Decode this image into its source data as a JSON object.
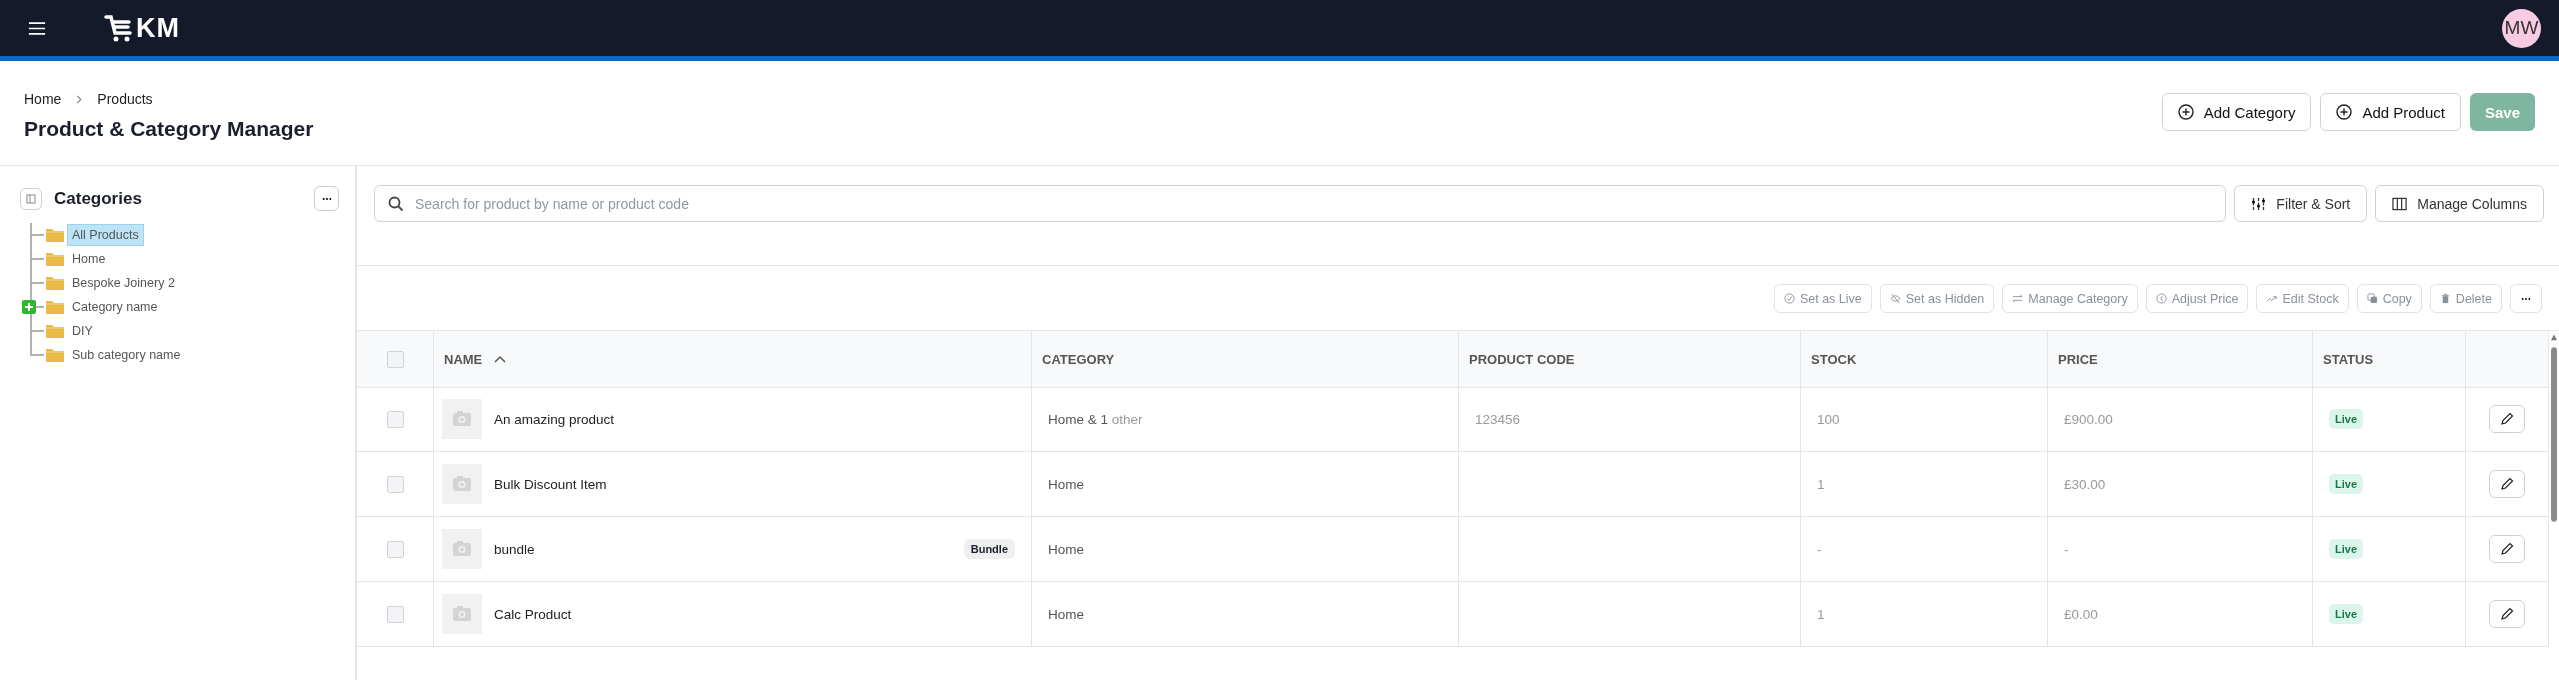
{
  "topbar": {
    "logo_text": "KM",
    "avatar": "MW"
  },
  "breadcrumb": [
    {
      "label": "Home"
    },
    {
      "label": "Products"
    }
  ],
  "page_title": "Product & Category Manager",
  "header_buttons": [
    {
      "label": "Add Category",
      "kind": "outline"
    },
    {
      "label": "Add Product",
      "kind": "outline"
    },
    {
      "label": "Save",
      "kind": "primary",
      "disabled": true
    }
  ],
  "sidebar": {
    "title": "Categories",
    "items": [
      {
        "label": "All Products",
        "selected": true,
        "drop_target": false
      },
      {
        "label": "Home",
        "selected": false,
        "drop_target": false
      },
      {
        "label": "Bespoke Joinery 2",
        "selected": false,
        "drop_target": false
      },
      {
        "label": "Category name",
        "selected": false,
        "drop_target": true
      },
      {
        "label": "DIY",
        "selected": false,
        "drop_target": false
      },
      {
        "label": "Sub category name",
        "selected": false,
        "drop_target": false
      }
    ]
  },
  "search": {
    "placeholder": "Search for product by name or product code"
  },
  "tool_buttons": [
    {
      "label": "Filter & Sort",
      "kind": "filter"
    },
    {
      "label": "Manage Columns",
      "kind": "columns"
    }
  ],
  "bulk_actions": [
    {
      "label": "Set as Live",
      "kind": "live",
      "disabled": true
    },
    {
      "label": "Set as Hidden",
      "kind": "hidden",
      "disabled": true
    },
    {
      "label": "Manage Category",
      "kind": "category",
      "disabled": true
    },
    {
      "label": "Adjust Price",
      "kind": "price",
      "disabled": true
    },
    {
      "label": "Edit Stock",
      "kind": "stock",
      "disabled": true
    },
    {
      "label": "Copy",
      "kind": "copy",
      "disabled": true
    },
    {
      "label": "Delete",
      "kind": "delete",
      "disabled": true
    }
  ],
  "table": {
    "select_all_checked": false,
    "columns": [
      {
        "label": "NAME",
        "sorted": true
      },
      {
        "label": "CATEGORY",
        "sorted": false
      },
      {
        "label": "PRODUCT CODE",
        "sorted": false
      },
      {
        "label": "STOCK",
        "sorted": false
      },
      {
        "label": "PRICE",
        "sorted": false
      },
      {
        "label": "STATUS",
        "sorted": false
      }
    ],
    "rows": [
      {
        "checked": false,
        "name": "An amazing product",
        "badge": "",
        "category": "Home & 1",
        "category_more": "other",
        "code": "123456",
        "stock": "100",
        "price": "£900.00",
        "status": "Live"
      },
      {
        "checked": false,
        "name": "Bulk Discount Item",
        "badge": "",
        "category": "Home",
        "category_more": "",
        "code": "",
        "stock": "1",
        "price": "£30.00",
        "status": "Live"
      },
      {
        "checked": false,
        "name": "bundle",
        "badge": "Bundle",
        "category": "Home",
        "category_more": "",
        "code": "",
        "stock": "-",
        "price": "-",
        "status": "Live"
      },
      {
        "checked": false,
        "name": "Calc Product",
        "badge": "",
        "category": "Home",
        "category_more": "",
        "code": "",
        "stock": "1",
        "price": "£0.00",
        "status": "Live"
      }
    ]
  }
}
